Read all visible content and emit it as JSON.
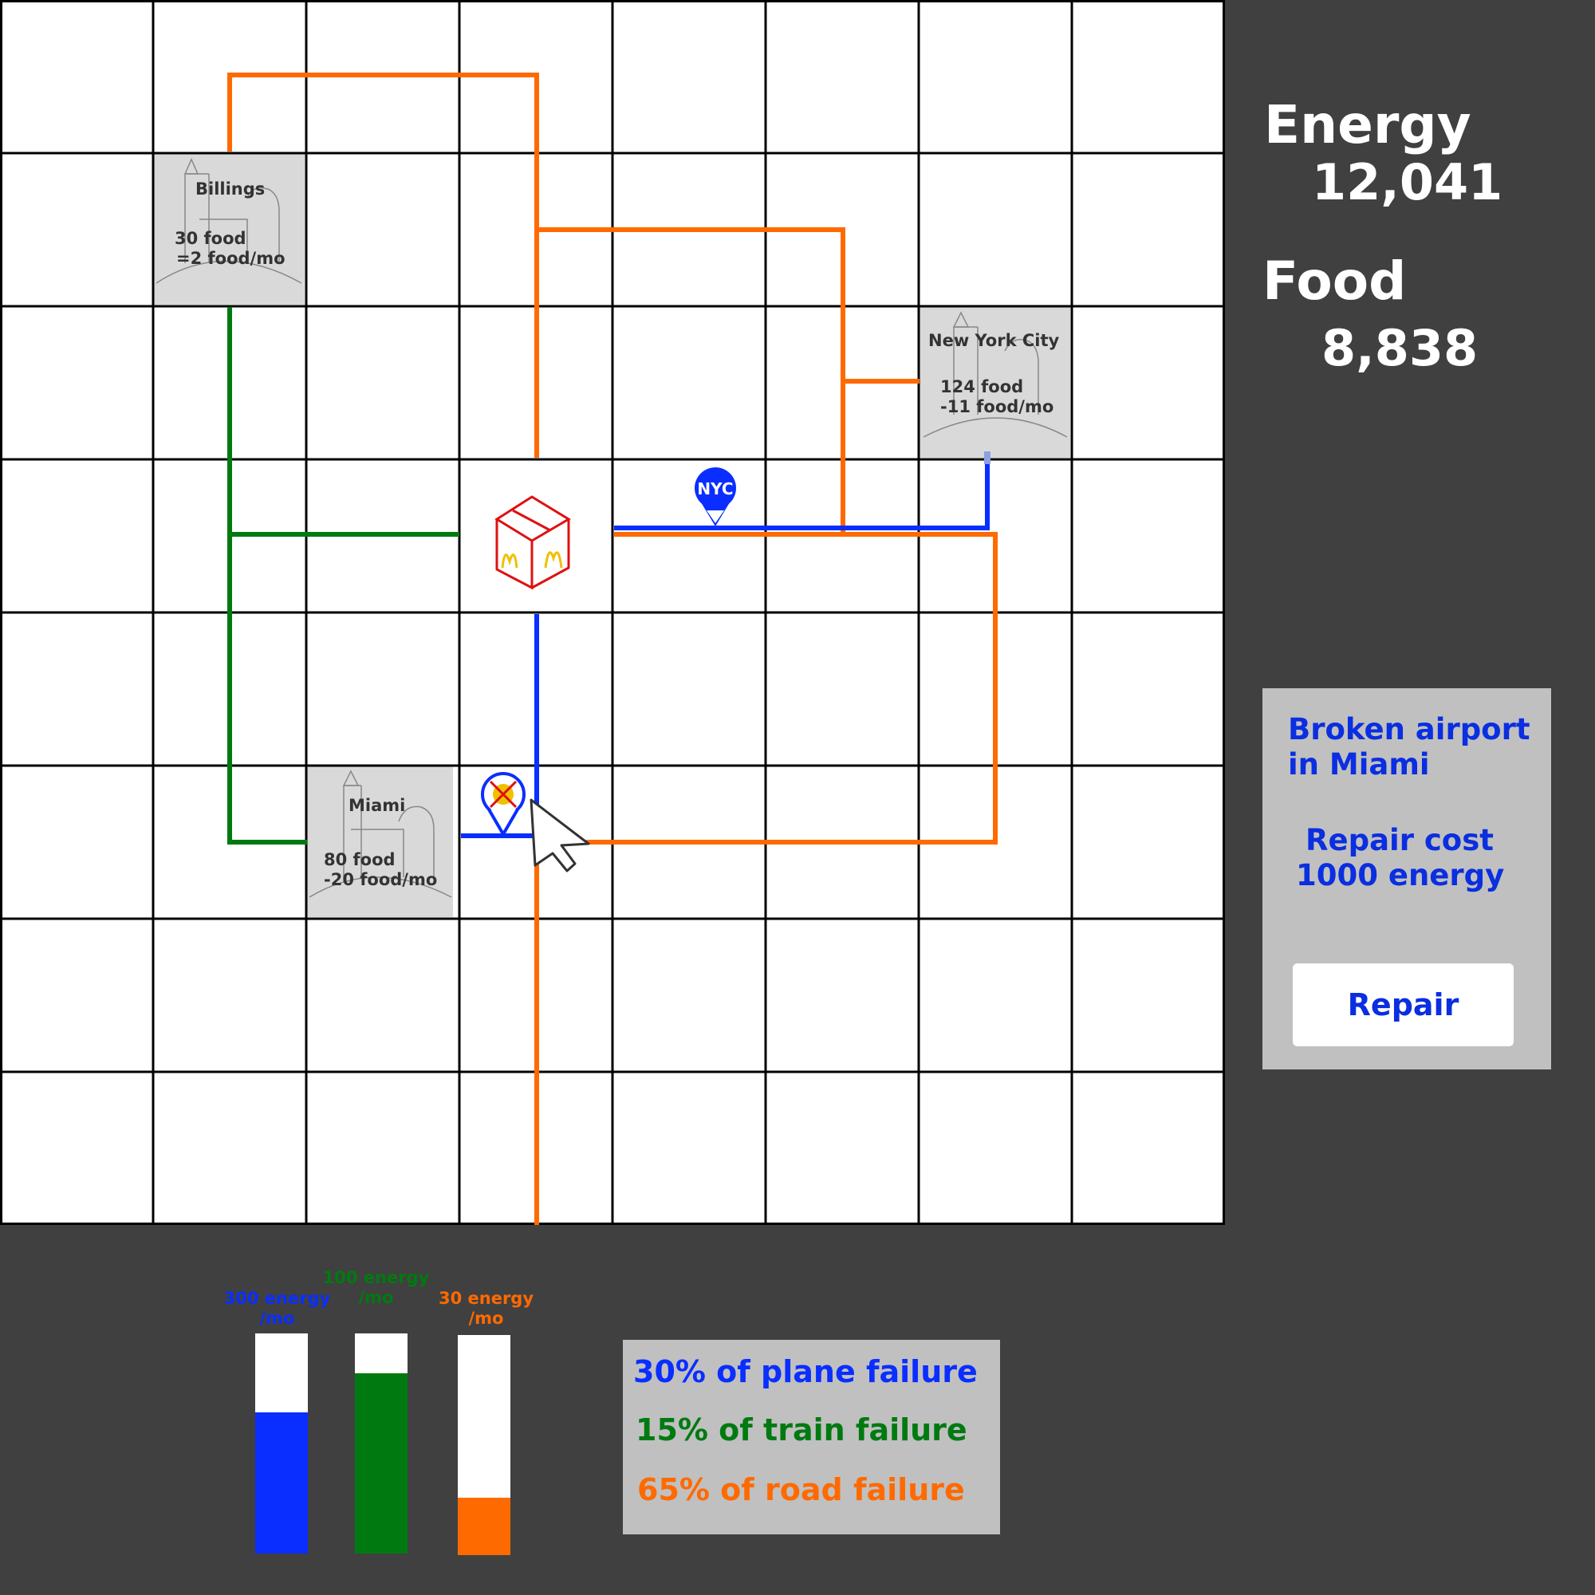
{
  "stats": {
    "energy_label": "Energy",
    "energy_value": "12,041",
    "food_label": "Food",
    "food_value": "8,838"
  },
  "cities": [
    {
      "name": "Billings",
      "food": "30 food",
      "rate": "=2 food/mo"
    },
    {
      "name": "New York City",
      "food": "124 food",
      "rate": "-11 food/mo"
    },
    {
      "name": "Miami",
      "food": "80 food",
      "rate": "-20 food/mo"
    }
  ],
  "markers": {
    "nyc_airport": "NYC"
  },
  "alert": {
    "title_line1": "Broken airport",
    "title_line2": "in Miami",
    "cost_line1": "Repair cost",
    "cost_line2": "1000 energy",
    "button_label": "Repair"
  },
  "energy_bars": [
    {
      "line1": "300 energy",
      "line2": "/mo",
      "fill_fraction": 0.64,
      "color": "#0a2eff"
    },
    {
      "line1": "100 energy",
      "line2": "/mo",
      "fill_fraction": 0.82,
      "color": "#007a10"
    },
    {
      "line1": "30 energy",
      "line2": "/mo",
      "fill_fraction": 0.26,
      "color": "#ff6a00"
    }
  ],
  "failures": {
    "plane": "30% of plane failure",
    "train": "15% of train failure",
    "road": "65% of road failure"
  },
  "colors": {
    "plane": "#0a2eff",
    "train": "#007a10",
    "road": "#ff6a00",
    "panel": "#c0c0c0",
    "background": "#404040"
  }
}
